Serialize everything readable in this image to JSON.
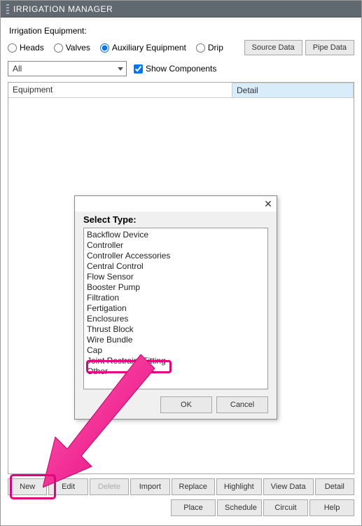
{
  "window": {
    "title": "IRRIGATION MANAGER"
  },
  "equipment": {
    "label": "Irrigation Equipment:",
    "options": {
      "heads": "Heads",
      "valves": "Valves",
      "aux": "Auxiliary Equipment",
      "drip": "Drip"
    },
    "selected": "aux"
  },
  "topButtons": {
    "source": "Source Data",
    "pipe": "Pipe Data"
  },
  "filter": {
    "combo_value": "All",
    "show_components": "Show Components"
  },
  "columns": {
    "equipment": "Equipment",
    "detail": "Detail"
  },
  "actions": {
    "new": "New",
    "edit": "Edit",
    "delete": "Delete",
    "import": "Import",
    "replace": "Replace",
    "highlight": "Highlight",
    "viewData": "View Data",
    "detail": "Detail"
  },
  "bottomActions": {
    "place": "Place",
    "schedule": "Schedule",
    "circuit": "Circuit",
    "help": "Help"
  },
  "modal": {
    "title": "Select Type:",
    "items": [
      "Backflow Device",
      "Controller",
      "Controller Accessories",
      "Central Control",
      "Flow Sensor",
      "Booster Pump",
      "Filtration",
      "Fertigation",
      "Enclosures",
      "Thrust Block",
      "Wire Bundle",
      "Cap",
      "Joint Restraint Fitting",
      "Other"
    ],
    "ok": "OK",
    "cancel": "Cancel"
  }
}
